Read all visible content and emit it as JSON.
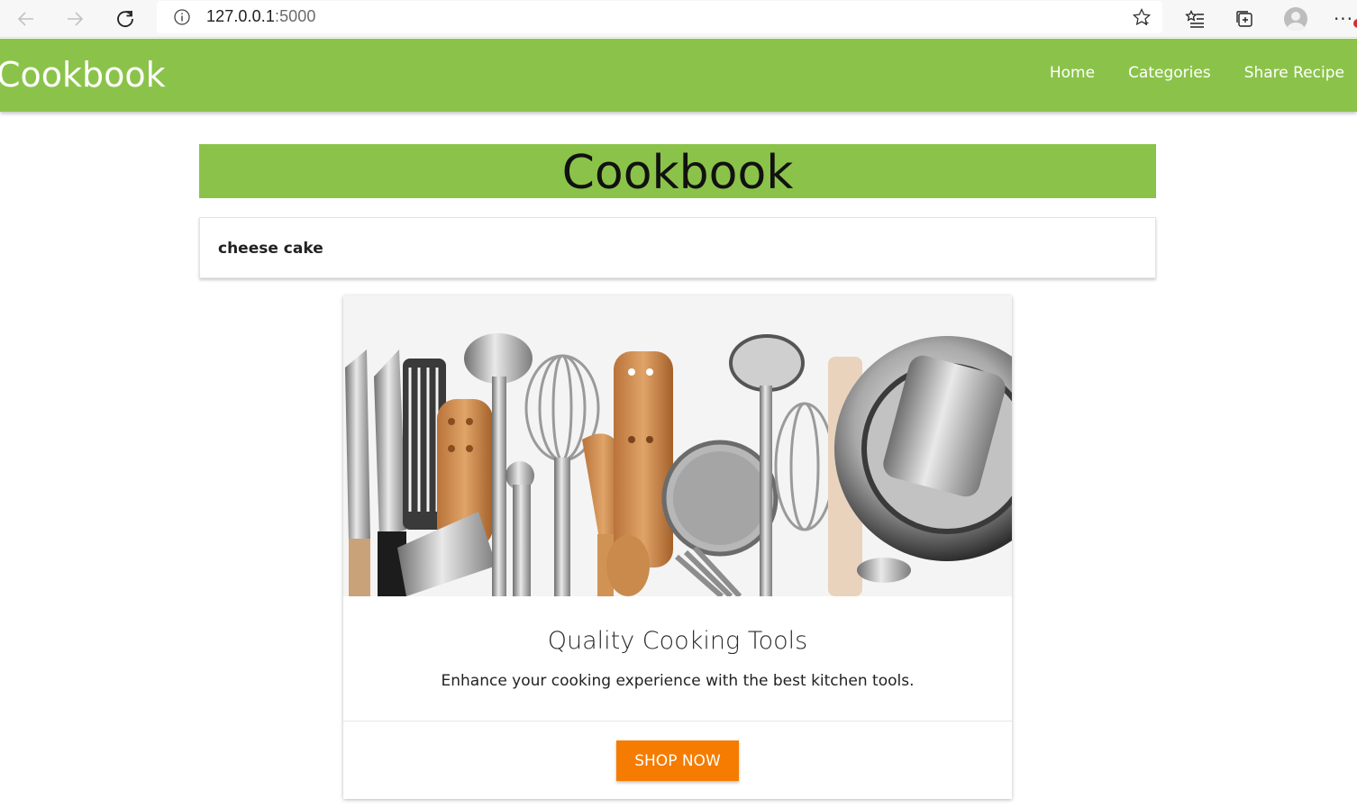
{
  "browser": {
    "url_host": "127.0.0.1",
    "url_port": ":5000",
    "icons": [
      "back-arrow-icon",
      "forward-arrow-icon",
      "refresh-icon",
      "info-icon",
      "favorite-star-icon",
      "favorites-list-icon",
      "collections-icon",
      "profile-avatar",
      "more-menu-icon"
    ]
  },
  "navbar": {
    "brand": "Cookbook",
    "links": [
      {
        "label": "Home"
      },
      {
        "label": "Categories"
      },
      {
        "label": "Share Recipe"
      }
    ],
    "color": "#8bc34a"
  },
  "banner": {
    "title": "Cookbook"
  },
  "search": {
    "value": "cheese cake"
  },
  "product_card": {
    "title": "Quality Cooking Tools",
    "text": "Enhance your cooking experience with the best kitchen tools.",
    "button_label": "SHOP NOW",
    "button_color": "#f57c00"
  }
}
